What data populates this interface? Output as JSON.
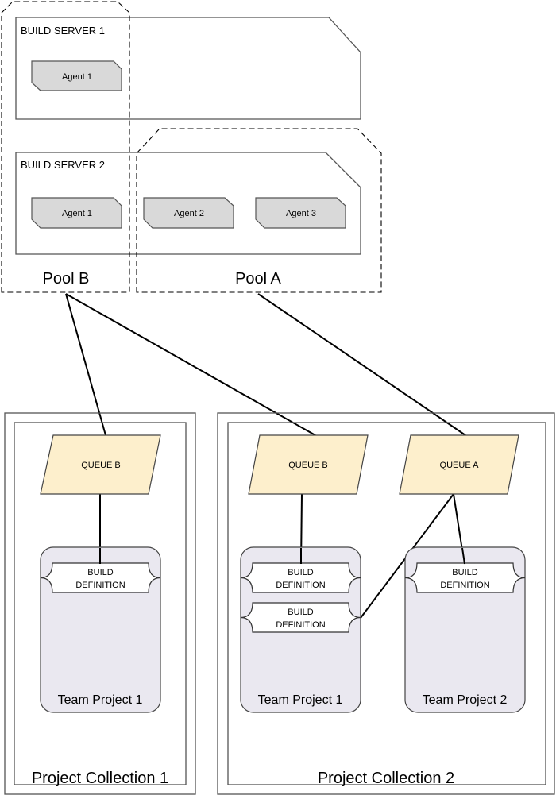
{
  "servers": [
    {
      "label": "BUILD SERVER 1",
      "agents": [
        "Agent 1"
      ]
    },
    {
      "label": "BUILD SERVER 2",
      "agents": [
        "Agent 1",
        "Agent 2",
        "Agent 3"
      ]
    }
  ],
  "pools": [
    {
      "label": "Pool B"
    },
    {
      "label": "Pool A"
    }
  ],
  "collections": [
    {
      "label": "Project Collection 1",
      "queues": [
        "QUEUE B"
      ],
      "projects": [
        {
          "label": "Team Project 1",
          "definitions": [
            "BUILD\nDEFINITION"
          ]
        }
      ]
    },
    {
      "label": "Project Collection 2",
      "queues": [
        "QUEUE B",
        "QUEUE A"
      ],
      "projects": [
        {
          "label": "Team Project 1",
          "definitions": [
            "BUILD\nDEFINITION",
            "BUILD\nDEFINITION"
          ]
        },
        {
          "label": "Team Project 2",
          "definitions": [
            "BUILD\nDEFINITION"
          ]
        }
      ]
    }
  ],
  "definition_line1": "BUILD",
  "definition_line2": "DEFINITION",
  "colors": {
    "agent_fill": "#d9d9d9",
    "queue_fill": "#fdefcc",
    "project_fill": "#eae8f0",
    "stroke": "#404040"
  }
}
